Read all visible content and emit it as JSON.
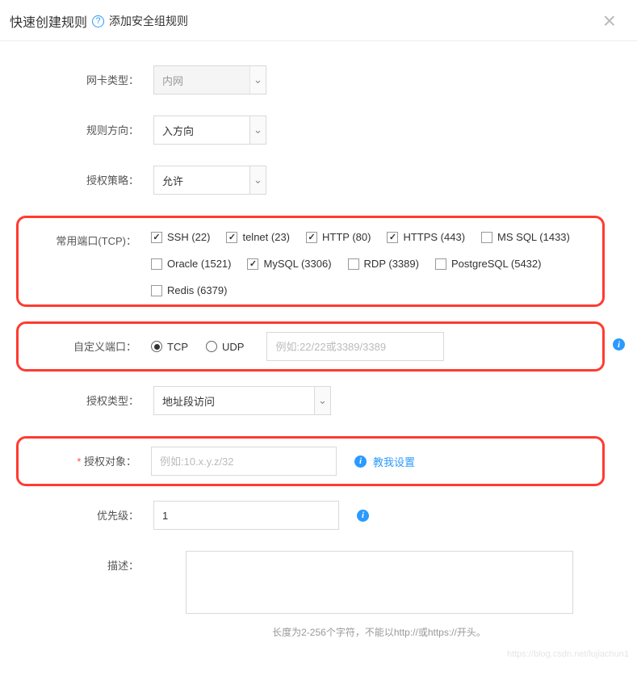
{
  "header": {
    "title": "快速创建规则",
    "subtitle": "添加安全组规则"
  },
  "form": {
    "nic_type": {
      "label": "网卡类型：",
      "value": "内网"
    },
    "direction": {
      "label": "规则方向：",
      "value": "入方向"
    },
    "auth_policy": {
      "label": "授权策略：",
      "value": "允许"
    },
    "common_ports": {
      "label": "常用端口(TCP)：",
      "items": [
        {
          "label": "SSH (22)",
          "checked": true
        },
        {
          "label": "telnet (23)",
          "checked": true
        },
        {
          "label": "HTTP (80)",
          "checked": true
        },
        {
          "label": "HTTPS (443)",
          "checked": true
        },
        {
          "label": "MS SQL (1433)",
          "checked": false
        },
        {
          "label": "Oracle (1521)",
          "checked": false
        },
        {
          "label": "MySQL (3306)",
          "checked": true
        },
        {
          "label": "RDP (3389)",
          "checked": false
        },
        {
          "label": "PostgreSQL (5432)",
          "checked": false
        },
        {
          "label": "Redis (6379)",
          "checked": false
        }
      ]
    },
    "custom_port": {
      "label": "自定义端口：",
      "protocols": [
        {
          "label": "TCP",
          "checked": true
        },
        {
          "label": "UDP",
          "checked": false
        }
      ],
      "placeholder": "例如:22/22或3389/3389"
    },
    "auth_type": {
      "label": "授权类型：",
      "value": "地址段访问"
    },
    "auth_object": {
      "label": "授权对象：",
      "placeholder": "例如:10.x.y.z/32",
      "help_link": "教我设置"
    },
    "priority": {
      "label": "优先级：",
      "value": "1"
    },
    "description": {
      "label": "描述：",
      "hint": "长度为2-256个字符，不能以http://或https://开头。"
    }
  },
  "watermark": "https://blog.csdn.net/lujiachun1"
}
